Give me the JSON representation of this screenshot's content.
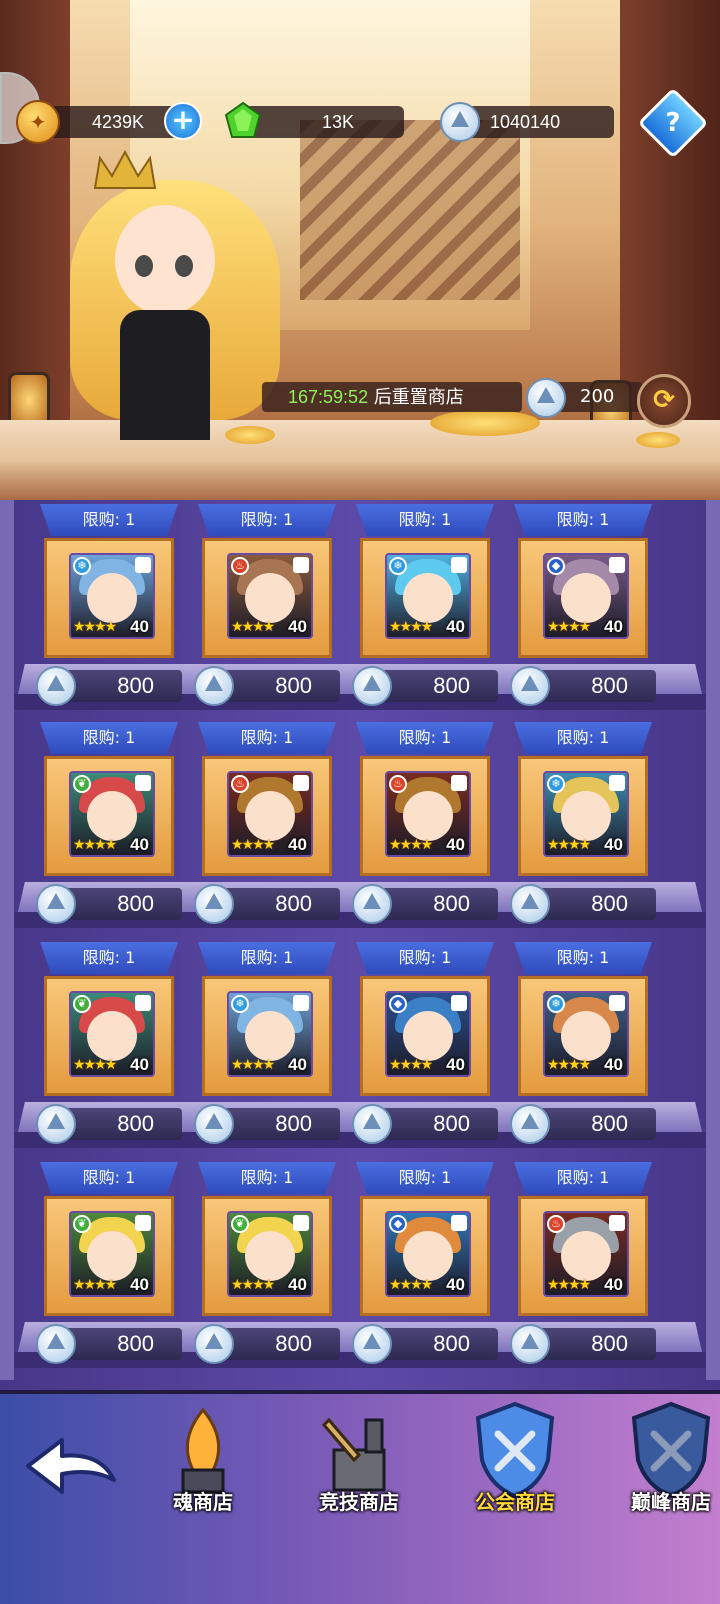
{
  "resources": {
    "gold": {
      "value": "4239K",
      "icon": "gold-coin-icon"
    },
    "gems": {
      "value": "13K",
      "icon": "green-gem-icon"
    },
    "guild_coin": {
      "value": "1040140",
      "icon": "guild-coin-icon"
    },
    "help_label": "?"
  },
  "reset": {
    "timer": "167:59:52",
    "text": "后重置商店",
    "cost": "200"
  },
  "items": [
    {
      "limit": "限购: 1",
      "stars": "★★★★",
      "level": "40",
      "price": "800",
      "element": "ice",
      "color": "#6fa3d8",
      "cap": "#7fb4e3"
    },
    {
      "limit": "限购: 1",
      "stars": "★★★★",
      "level": "40",
      "price": "800",
      "element": "fire",
      "color": "#8a5a3c",
      "cap": "#a87552"
    },
    {
      "limit": "限购: 1",
      "stars": "★★★★",
      "level": "40",
      "price": "800",
      "element": "ice",
      "color": "#4fb0e0",
      "cap": "#5fcaf0"
    },
    {
      "limit": "限购: 1",
      "stars": "★★★★",
      "level": "40",
      "price": "800",
      "element": "water",
      "color": "#7a5a86",
      "cap": "#a48aa8"
    },
    {
      "limit": "限购: 1",
      "stars": "★★★★",
      "level": "40",
      "price": "800",
      "element": "nature",
      "color": "#3c8b78",
      "cap": "#d84a4a"
    },
    {
      "limit": "限购: 1",
      "stars": "★★★★",
      "level": "40",
      "price": "800",
      "element": "fire",
      "color": "#7a2b20",
      "cap": "#b0782e"
    },
    {
      "limit": "限购: 1",
      "stars": "★★★★",
      "level": "40",
      "price": "800",
      "element": "fire",
      "color": "#7a2b20",
      "cap": "#b0782e"
    },
    {
      "limit": "限购: 1",
      "stars": "★★★★",
      "level": "40",
      "price": "800",
      "element": "ice",
      "color": "#3d8fb0",
      "cap": "#e5c55a"
    },
    {
      "limit": "限购: 1",
      "stars": "★★★★",
      "level": "40",
      "price": "800",
      "element": "nature",
      "color": "#3c8b78",
      "cap": "#d84a4a"
    },
    {
      "limit": "限购: 1",
      "stars": "★★★★",
      "level": "40",
      "price": "800",
      "element": "ice",
      "color": "#6fa3d8",
      "cap": "#7fb4e3"
    },
    {
      "limit": "限购: 1",
      "stars": "★★★★",
      "level": "40",
      "price": "800",
      "element": "water",
      "color": "#2a4f8e",
      "cap": "#3b7fc6"
    },
    {
      "limit": "限购: 1",
      "stars": "★★★★",
      "level": "40",
      "price": "800",
      "element": "ice",
      "color": "#3f5f88",
      "cap": "#d8884a"
    },
    {
      "limit": "限购: 1",
      "stars": "★★★★",
      "level": "40",
      "price": "800",
      "element": "nature",
      "color": "#4d8a3a",
      "cap": "#f2d44e"
    },
    {
      "limit": "限购: 1",
      "stars": "★★★★",
      "level": "40",
      "price": "800",
      "element": "nature",
      "color": "#4d8a3a",
      "cap": "#f2d44e"
    },
    {
      "limit": "限购: 1",
      "stars": "★★★★",
      "level": "40",
      "price": "800",
      "element": "water",
      "color": "#2f78b8",
      "cap": "#e08a3e"
    },
    {
      "limit": "限购: 1",
      "stars": "★★★★",
      "level": "40",
      "price": "800",
      "element": "fire",
      "color": "#7a2b20",
      "cap": "#9aa0a8"
    }
  ],
  "nav": {
    "back_icon": "back-arrow-icon",
    "tabs": [
      {
        "label": "魂商店",
        "icon": "soul-shop-icon",
        "active": false
      },
      {
        "label": "竞技商店",
        "icon": "arena-shop-icon",
        "active": false
      },
      {
        "label": "公会商店",
        "icon": "guild-shop-icon",
        "active": true
      },
      {
        "label": "巅峰商店",
        "icon": "peak-shop-icon",
        "active": false
      }
    ]
  },
  "colors": {
    "accent_active_tab": "#ffd83b",
    "timer_green": "#8ff25a",
    "limit_banner": "#2f4bbd",
    "card_orange": "#e49b3f"
  }
}
